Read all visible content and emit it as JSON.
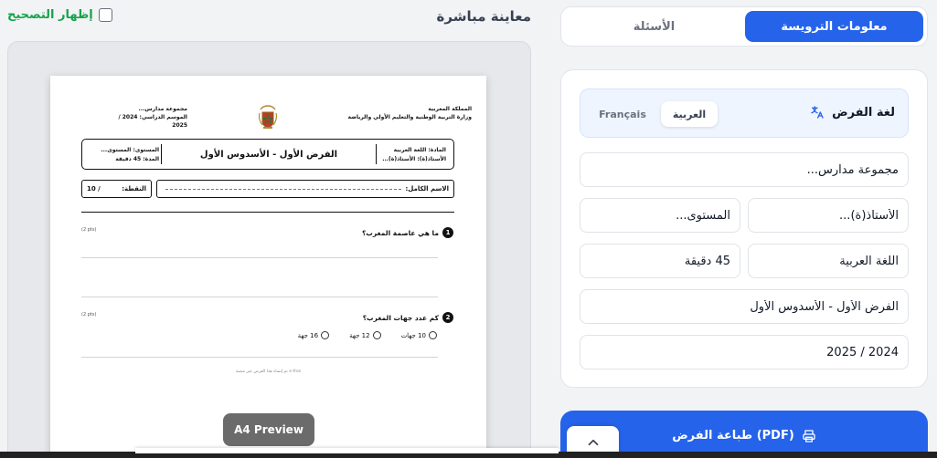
{
  "tabs": {
    "header_info": "معلومات الترويسة",
    "questions": "الأسئلة"
  },
  "language": {
    "title": "لغة الفرض",
    "arabic": "العربية",
    "french": "Français",
    "icon": "translate-icon"
  },
  "fields": {
    "school": "مجموعة مدارس...",
    "teacher": "الأستاذ(ة)...",
    "level": "المستوى...",
    "subject": "اللغة العربية",
    "duration": "45 دقيقة",
    "exam_title": "الفرض الأول - الأسدوس الأول",
    "school_year": "2024 / 2025"
  },
  "print_button": {
    "label": "طباعة الفرض (PDF)",
    "icon": "printer-icon"
  },
  "preview": {
    "title": "معاينة مباشرة",
    "show_correction": "إظهار التصحيح",
    "badge": "A4 Preview"
  },
  "sheet": {
    "kingdom": "المملكة المغربية",
    "ministry": "وزارة التربية الوطنية والتعليم الأولي والرياضة",
    "school": "مجموعة مدارس...",
    "year_line": "الموسم الدراسي: 2024 / 2025",
    "subject_line": "المادة: اللغة العربية",
    "teacher_line": "الأستاذ(ة): الأستاذ(ة)...",
    "exam_title": "الفرض الأول - الأسدوس الأول",
    "level_line": "المستوى: المستوى...",
    "duration_line": "المدة: 45 دقيقة",
    "name_label": "الاسم الكامل:",
    "grade_label": "النقطة:",
    "grade_value": "/ 10",
    "q1_num": "1",
    "q1_text": "ما هي عاصمة المغرب؟",
    "q1_pts": "(2 pts)",
    "q2_num": "2",
    "q2_text": "كم عدد جهات المغرب؟",
    "q2_pts": "(2 pts)",
    "q2_options": [
      "10 جهات",
      "12 جهة",
      "16 جهة"
    ],
    "footer": "تم إنشاء هذا الفرض عبر منصة e-fros"
  }
}
